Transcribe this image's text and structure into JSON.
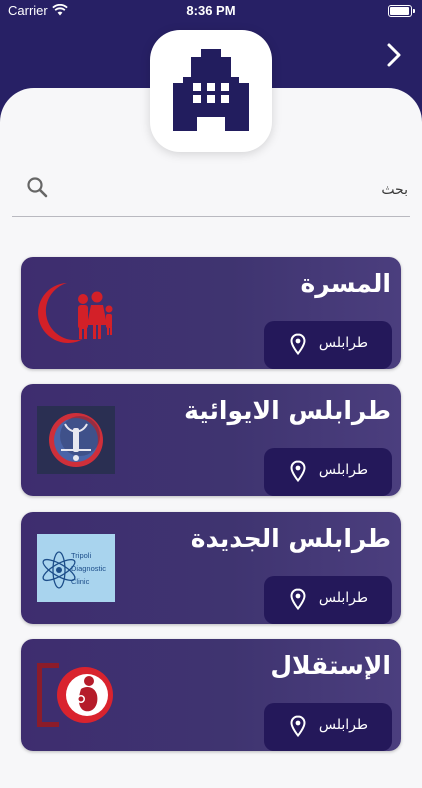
{
  "status_bar": {
    "carrier": "Carrier",
    "time": "8:36 PM"
  },
  "header": {
    "logo_icon": "hospital-building-icon",
    "forward_icon": "chevron-right-icon"
  },
  "search": {
    "placeholder": "بحث",
    "icon": "search-icon"
  },
  "colors": {
    "header_bg": "#272065",
    "card_bg": "#3f3470",
    "location_button_bg": "#24185a",
    "logo_fill": "#221d5e"
  },
  "hospitals": [
    {
      "name": "المسرة",
      "location": "طرابلس",
      "logo": "red-crescent-family-logo"
    },
    {
      "name": "طرابلس الايوائية",
      "location": "طرابلس",
      "logo": "tripoli-shelter-crest-logo"
    },
    {
      "name": "طرابلس الجديدة",
      "location": "طرابلس",
      "logo": "tripoli-diagnostic-clinic-logo",
      "logo_text": [
        "Tripoli",
        "Diagnostic",
        "Clinic"
      ]
    },
    {
      "name": "الإستقلال",
      "location": "طرابلس",
      "logo": "mother-child-logo"
    }
  ]
}
